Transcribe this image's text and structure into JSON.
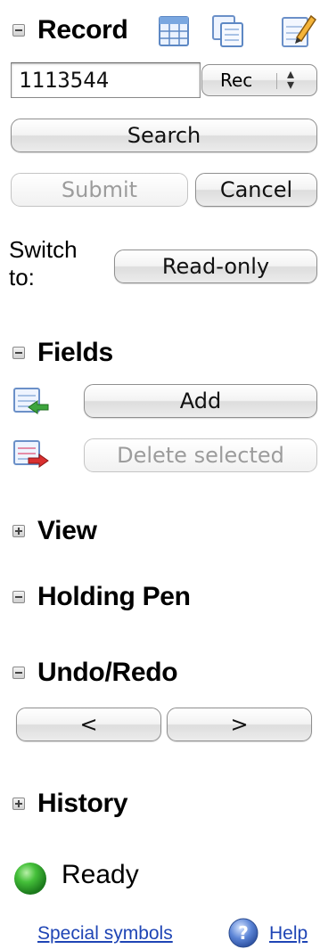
{
  "record": {
    "title": "Record",
    "input_value": "1113544",
    "select_value": "Rec",
    "search_label": "Search",
    "submit_label": "Submit",
    "cancel_label": "Cancel",
    "switch_label": "Switch to:",
    "switch_button": "Read-only"
  },
  "fields": {
    "title": "Fields",
    "add_label": "Add",
    "delete_label": "Delete selected"
  },
  "view": {
    "title": "View"
  },
  "holding_pen": {
    "title": "Holding Pen"
  },
  "undo_redo": {
    "title": "Undo/Redo",
    "undo_label": "<",
    "redo_label": ">"
  },
  "history": {
    "title": "History"
  },
  "status": {
    "text": "Ready",
    "color": "#2ea82e"
  },
  "footer": {
    "special_symbols": "Special symbols",
    "help": "Help"
  },
  "icons": {
    "record_table": "table-icon",
    "record_copy": "copy-icon",
    "record_edit": "edit-icon",
    "field_add": "add-field-icon",
    "field_delete": "delete-field-icon",
    "help": "help-icon",
    "status": "status-light-icon"
  }
}
